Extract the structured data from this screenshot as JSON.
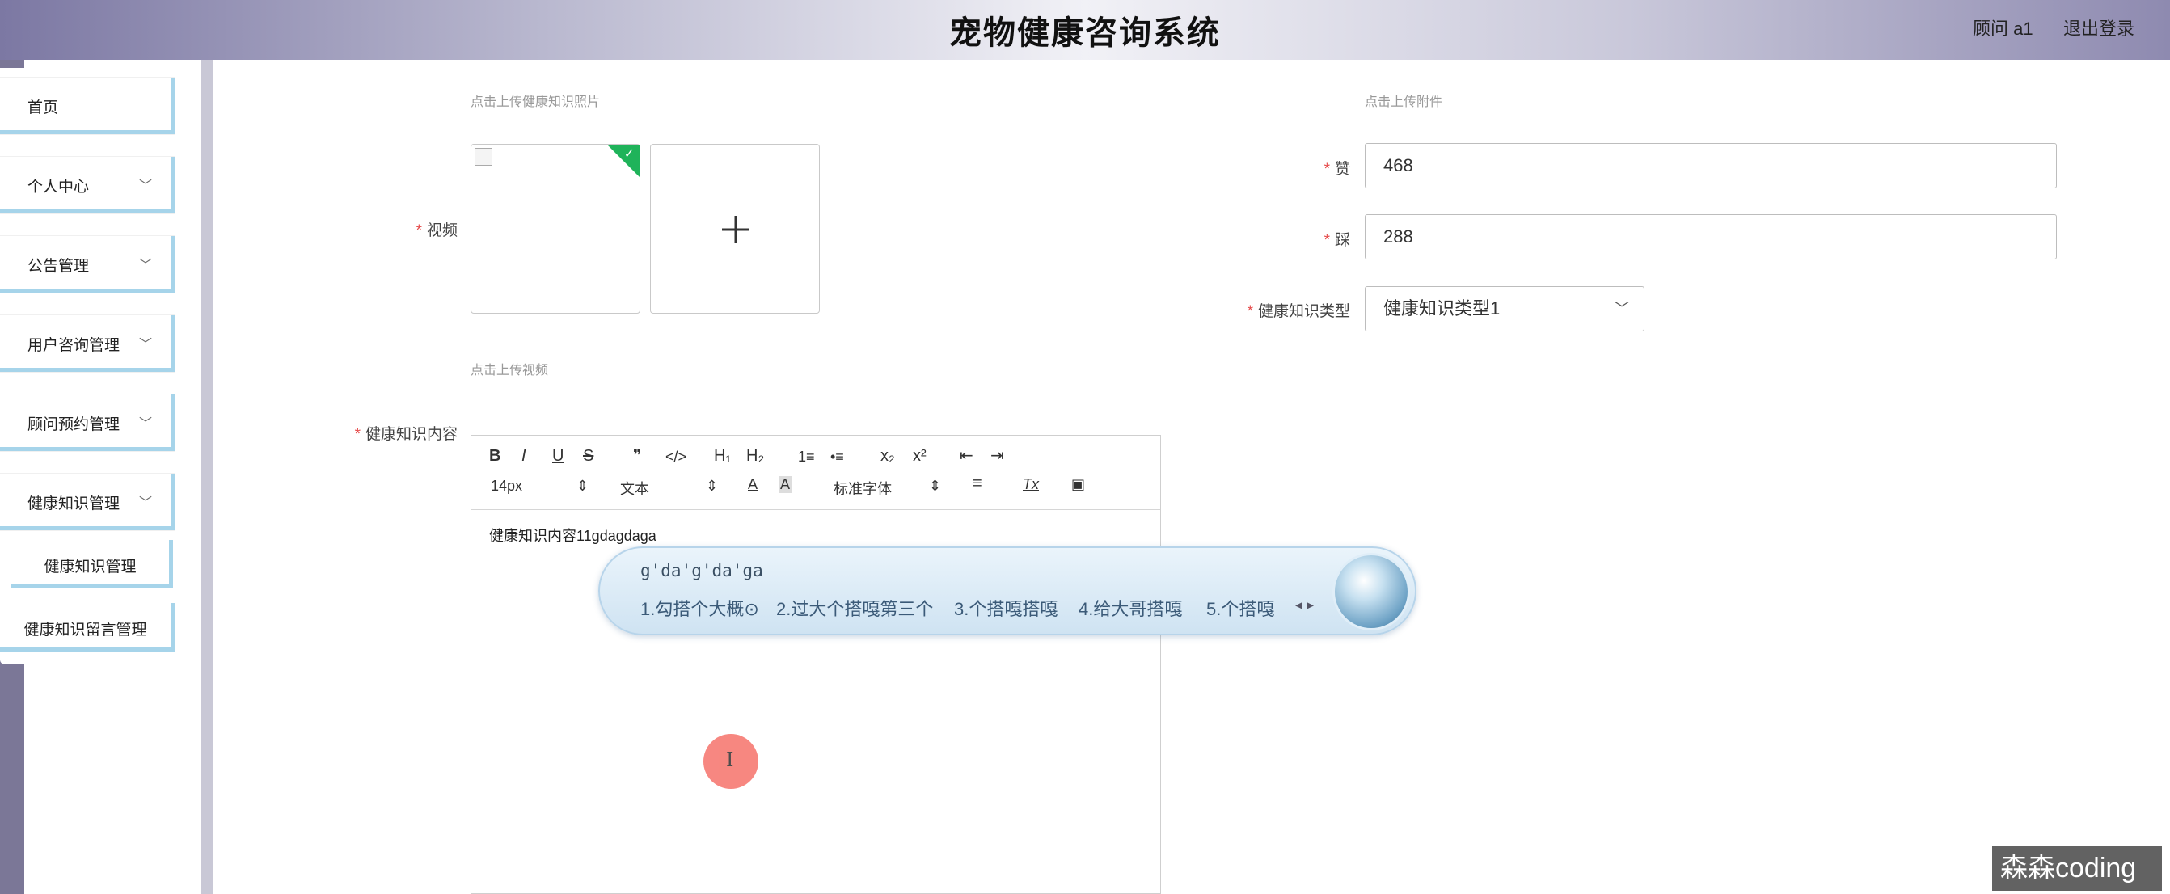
{
  "header": {
    "title": "宠物健康咨询系统",
    "user": "顾问 a1",
    "logout": "退出登录"
  },
  "sidebar": {
    "items": [
      {
        "label": "首页",
        "has_chevron": false
      },
      {
        "label": "个人中心",
        "has_chevron": true
      },
      {
        "label": "公告管理",
        "has_chevron": true
      },
      {
        "label": "用户咨询管理",
        "has_chevron": true
      },
      {
        "label": "顾问预约管理",
        "has_chevron": true
      },
      {
        "label": "健康知识管理",
        "has_chevron": true
      }
    ],
    "sub_items": [
      {
        "label": "健康知识管理"
      },
      {
        "label": "健康知识留言管理"
      }
    ]
  },
  "form": {
    "photo_hint": "点击上传健康知识照片",
    "attachment_hint": "点击上传附件",
    "video_label": "视频",
    "video_hint": "点击上传视频",
    "like_label": "赞",
    "like_value": "468",
    "dislike_label": "踩",
    "dislike_value": "288",
    "type_label": "健康知识类型",
    "type_value": "健康知识类型1",
    "content_label": "健康知识内容"
  },
  "editor": {
    "toolbar": {
      "bold": "B",
      "italic": "I",
      "underline": "U",
      "strike": "S",
      "quote": "❞",
      "code": "</>",
      "h1": "H₁",
      "h2": "H₂",
      "ordered_list": "1≡",
      "bullet_list": "•≡",
      "subscript": "x₂",
      "superscript": "x²",
      "outdent": "⇤",
      "indent": "⇥",
      "font_size": "14px",
      "block_type": "文本",
      "font_family": "标准字体",
      "text_color": "A",
      "bg_color": "A",
      "align": "≡",
      "clear_format": "Tx",
      "image": "▣"
    },
    "content": "健康知识内容11gdagdaga"
  },
  "ime": {
    "composition": "g'da'g'da'ga",
    "candidates": [
      "1.勾搭个大概⊙",
      "2.过大个搭嘎第三个",
      "3.个搭嘎搭嘎",
      "4.给大哥搭嘎",
      "5.个搭嘎"
    ],
    "arrows": "◂ ▸"
  },
  "watermark": "森森coding",
  "colors": {
    "sidebar_accent": "#a6d4ea",
    "required": "#e64b4b",
    "check": "#1fb35a"
  }
}
